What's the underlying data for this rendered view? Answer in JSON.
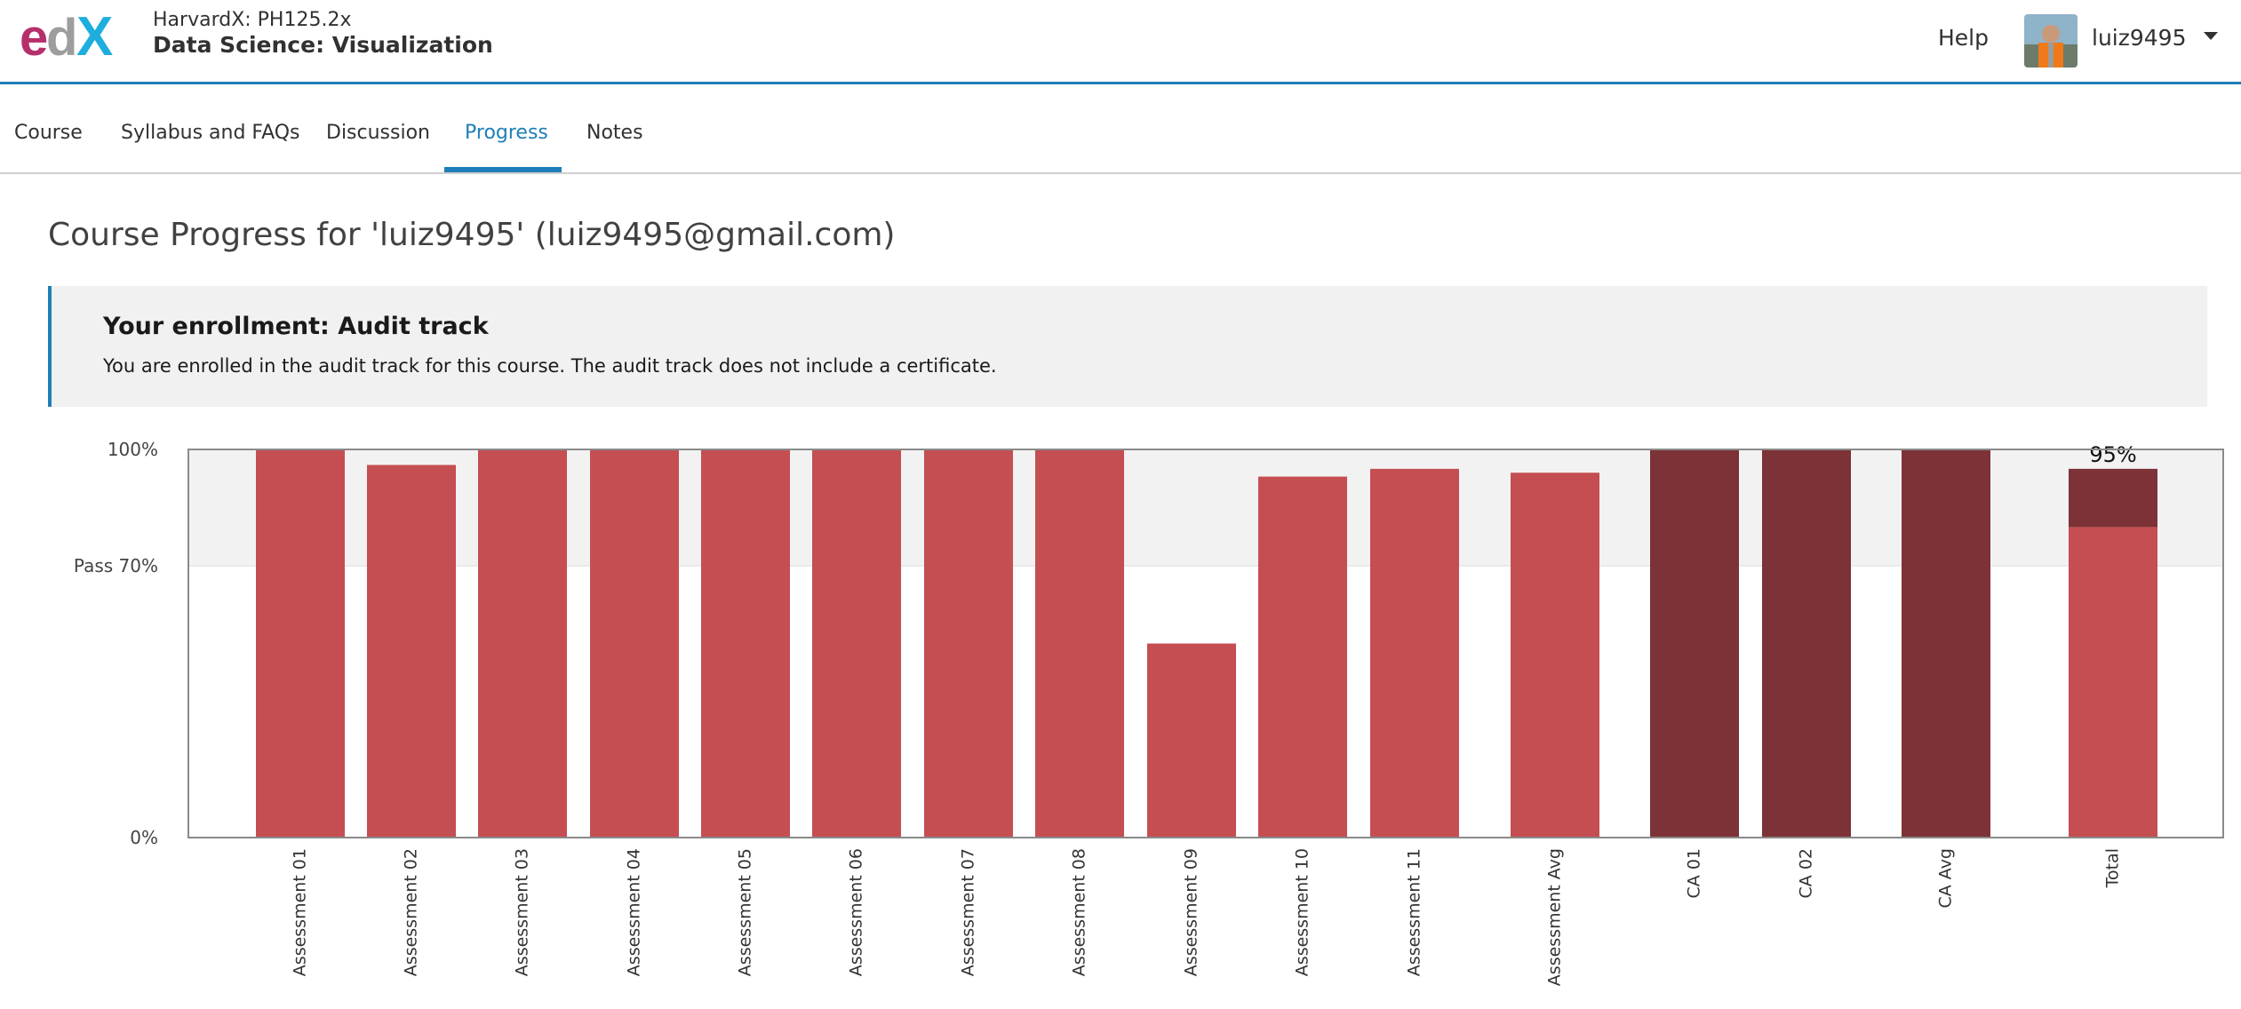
{
  "header": {
    "course_org": "HarvardX: PH125.2x",
    "course_title": "Data Science: Visualization",
    "help_label": "Help",
    "username": "luiz9495",
    "logo_text": "edX"
  },
  "tabs": [
    {
      "label": "Course",
      "active": false
    },
    {
      "label": "Syllabus and FAQs",
      "active": false
    },
    {
      "label": "Discussion",
      "active": false
    },
    {
      "label": "Progress",
      "active": true
    },
    {
      "label": "Notes",
      "active": false
    }
  ],
  "page_title": "Course Progress for 'luiz9495' (luiz9495@gmail.com)",
  "enrollment": {
    "title": "Your enrollment: Audit track",
    "text": "You are enrolled in the audit track for this course. The audit track does not include a certificate."
  },
  "colors": {
    "brand_blue": "#1e7fb8",
    "assessment_bar": "#c44e52",
    "comprehension_bar": "#7c3236",
    "pass_band": "#f2f2f2"
  },
  "chart_data": {
    "type": "bar",
    "ytick_labels": [
      "100%",
      "Pass 70%",
      "0%"
    ],
    "ylim": [
      0,
      100
    ],
    "pass_threshold": 70,
    "categories": [
      "Assessment 01",
      "Assessment 02",
      "Assessment 03",
      "Assessment 04",
      "Assessment 05",
      "Assessment 06",
      "Assessment 07",
      "Assessment 08",
      "Assessment 09",
      "Assessment 10",
      "Assessment 11",
      "Assessment Avg",
      "CA 01",
      "CA 02",
      "CA Avg",
      "Total"
    ],
    "values": [
      100,
      96,
      100,
      100,
      100,
      100,
      100,
      100,
      50,
      93,
      95,
      94,
      100,
      100,
      100,
      95
    ],
    "bar_kind": [
      "assessment",
      "assessment",
      "assessment",
      "assessment",
      "assessment",
      "assessment",
      "assessment",
      "assessment",
      "assessment",
      "assessment",
      "assessment",
      "assessment",
      "comprehension",
      "comprehension",
      "comprehension",
      "total"
    ],
    "total_segments": [
      {
        "kind": "assessment",
        "value": 80
      },
      {
        "kind": "comprehension",
        "value": 15
      }
    ],
    "total_label": "95%"
  }
}
